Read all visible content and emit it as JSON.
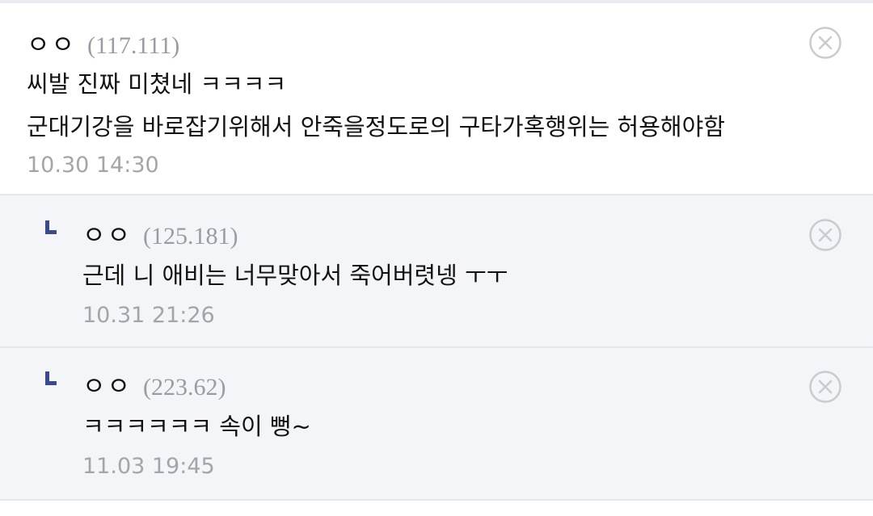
{
  "comments": [
    {
      "author": "ㅇㅇ",
      "ip": "(117.111)",
      "lines": [
        "씨발 진짜 미쳤네 ㅋㅋㅋㅋ",
        "군대기강을 바로잡기위해서 안죽을정도로의 구타가혹행위는 허용해야함"
      ],
      "date": "10.30 14:30"
    },
    {
      "author": "ㅇㅇ",
      "ip": "(125.181)",
      "lines": [
        "근데 니 애비는 너무맞아서 죽어버렷넹 ㅜㅜ"
      ],
      "date": "10.31 21:26"
    },
    {
      "author": "ㅇㅇ",
      "ip": "(223.62)",
      "lines": [
        "ㅋㅋㅋㅋㅋㅋ 속이 뻥~"
      ],
      "date": "11.03 19:45"
    }
  ],
  "icons": {
    "delete": "close-circle-icon",
    "reply": "reply-arrow-icon"
  },
  "colors": {
    "reply_marker": "#3b4a8f",
    "muted_text": "#9a9ca3",
    "reply_background": "#f4f5f9"
  }
}
